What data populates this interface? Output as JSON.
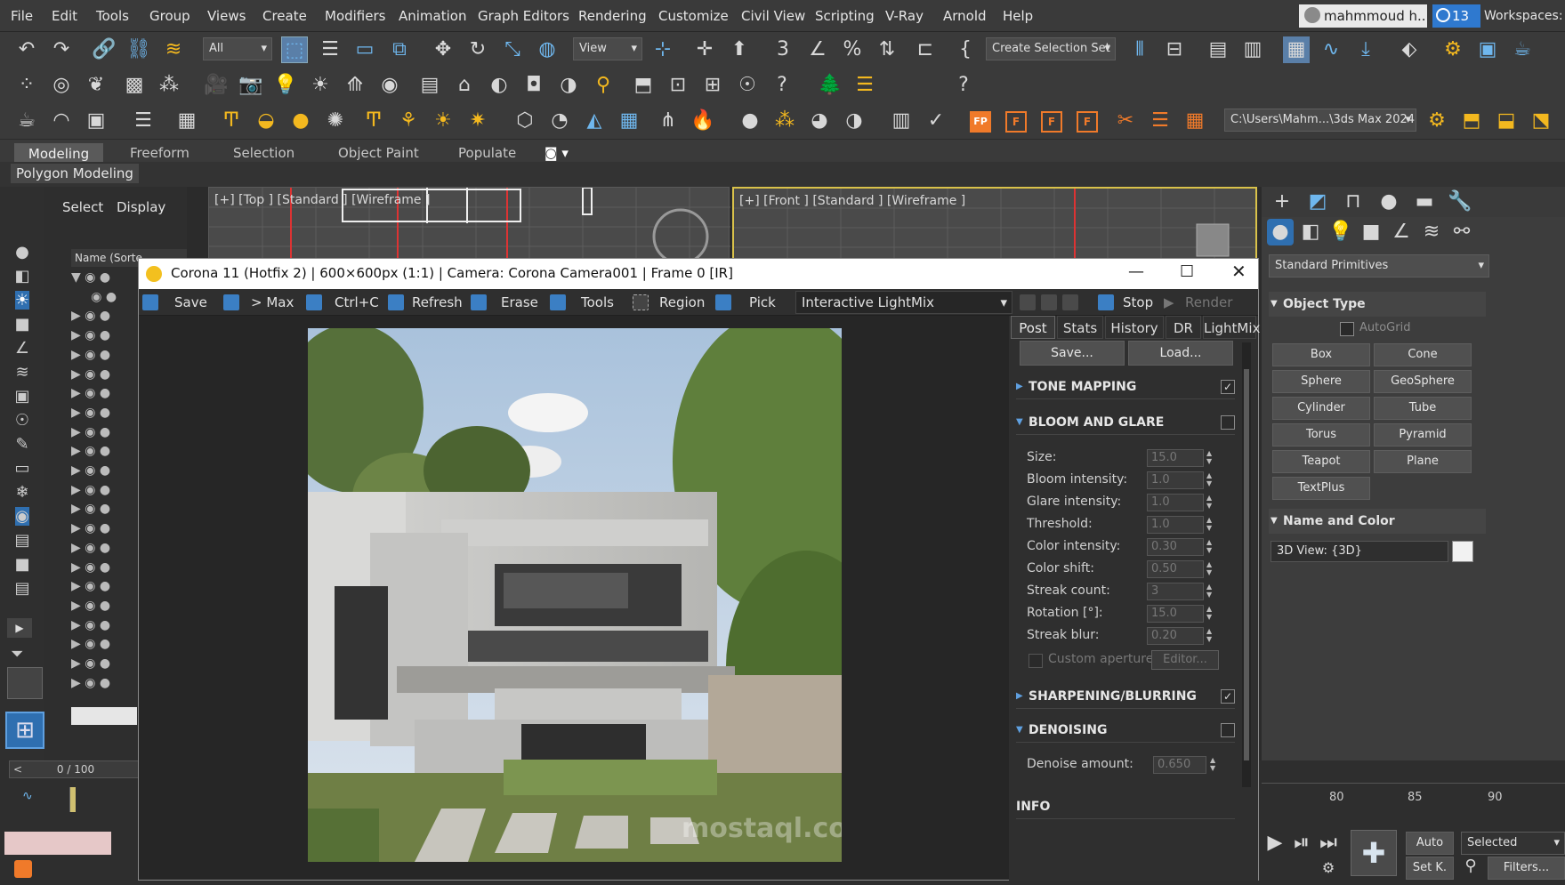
{
  "menu": [
    "File",
    "Edit",
    "Tools",
    "Group",
    "Views",
    "Create",
    "Modifiers",
    "Animation",
    "Graph Editors",
    "Rendering",
    "Customize",
    "Civil View",
    "Scripting",
    "V-Ray",
    "Arnold",
    "Help"
  ],
  "account": {
    "user": "mahmmoud h...",
    "count": "13",
    "workspaces_label": "Workspaces:"
  },
  "toolbar": {
    "selection_filter": "All",
    "ref_coord": "View",
    "selection_set": "Create Selection Set",
    "project_path": "C:\\Users\\Mahm...\\3ds Max 2024"
  },
  "corona_badges": [
    "FP",
    "F",
    "F",
    "F"
  ],
  "ribbon": {
    "tabs": [
      "Modeling",
      "Freeform",
      "Selection",
      "Object Paint",
      "Populate"
    ],
    "sub": "Polygon Modeling"
  },
  "explorer": {
    "tabs": [
      "Select",
      "Display"
    ],
    "column": "Name (Sorte"
  },
  "viewports": {
    "top": "[+] [Top ] [Standard ] [Wireframe ]",
    "front": "[+] [Front ] [Standard ] [Wireframe ]"
  },
  "command_panel": {
    "category": "Standard Primitives",
    "object_type_title": "Object Type",
    "autogrid": "AutoGrid",
    "buttons": [
      "Box",
      "Cone",
      "Sphere",
      "GeoSphere",
      "Cylinder",
      "Tube",
      "Torus",
      "Pyramid",
      "Teapot",
      "Plane",
      "TextPlus"
    ],
    "name_color_title": "Name and Color",
    "name_value": "3D View: {3D}"
  },
  "vfb": {
    "title": "Corona 11 (Hotfix 2) | 600×600px (1:1) | Camera: Corona Camera001 | Frame 0 [IR]",
    "toolbar": [
      "Save",
      "> Max",
      "Ctrl+C",
      "Refresh",
      "Erase",
      "Tools",
      "Region",
      "Pick"
    ],
    "lightmix": "Interactive LightMix",
    "stop": "Stop",
    "render": "Render",
    "tabs": [
      "Post",
      "Stats",
      "History",
      "DR",
      "LightMix"
    ],
    "save_btn": "Save...",
    "load_btn": "Load...",
    "sections": {
      "tone": "TONE MAPPING",
      "bloom": "BLOOM AND GLARE",
      "sharp": "SHARPENING/BLURRING",
      "denoise": "DENOISING",
      "info": "INFO"
    },
    "bloom_params": [
      {
        "label": "Size:",
        "value": "15.0"
      },
      {
        "label": "Bloom intensity:",
        "value": "1.0"
      },
      {
        "label": "Glare intensity:",
        "value": "1.0"
      },
      {
        "label": "Threshold:",
        "value": "1.0"
      },
      {
        "label": "Color intensity:",
        "value": "0.30"
      },
      {
        "label": "Color shift:",
        "value": "0.50"
      },
      {
        "label": "Streak count:",
        "value": "3"
      },
      {
        "label": "Rotation [°]:",
        "value": "15.0"
      },
      {
        "label": "Streak blur:",
        "value": "0.20"
      }
    ],
    "custom_aperture": "Custom aperture:",
    "editor": "Editor...",
    "denoise_label": "Denoise amount:",
    "denoise_value": "0.650",
    "watermark": "mostaql.com"
  },
  "timeline": {
    "counter": "0 / 100",
    "ticks": [
      "80",
      "85",
      "90"
    ],
    "auto": "Auto",
    "setk": "Set K.",
    "selected": "Selected",
    "filters": "Filters..."
  }
}
